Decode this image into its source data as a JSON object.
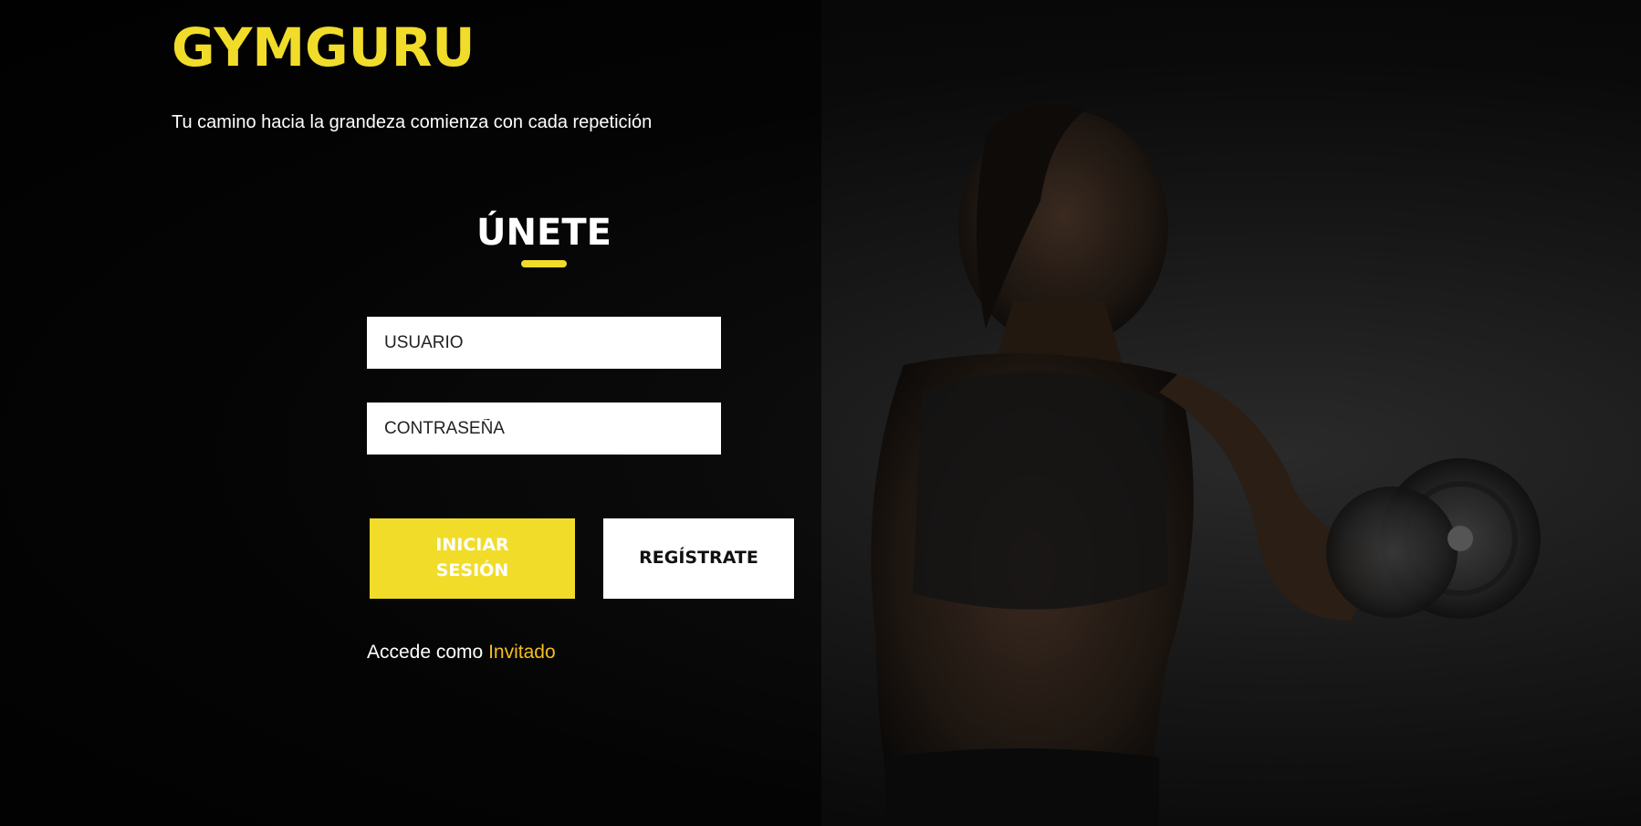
{
  "brand": {
    "name": "GYMGURU"
  },
  "tagline": "Tu camino hacia la grandeza comienza con cada repetición",
  "join": {
    "title": "ÚNETE"
  },
  "form": {
    "username_placeholder": "USUARIO",
    "password_placeholder": "CONTRASEÑA",
    "login_label": "INICIAR SESIÓN",
    "register_label": "REGÍSTRATE"
  },
  "guest": {
    "prefix": "Accede como",
    "link_label": "Invitado"
  },
  "colors": {
    "accent": "#f1dc2a",
    "link": "#f4bd1e",
    "background": "#050505"
  }
}
